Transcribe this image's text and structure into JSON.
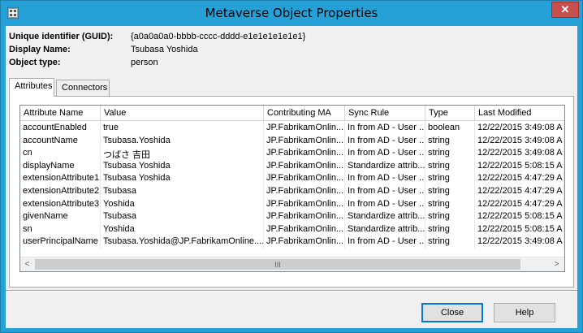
{
  "window": {
    "title": "Metaverse Object Properties",
    "close_glyph": "✕"
  },
  "object": {
    "guid_label": "Unique identifier (GUID):",
    "guid_value": "{a0a0a0a0-bbbb-cccc-dddd-e1e1e1e1e1e1}",
    "display_name_label": "Display Name:",
    "display_name_value": "Tsubasa Yoshida",
    "object_type_label": "Object type:",
    "object_type_value": "person"
  },
  "tabs": [
    {
      "label": "Attributes",
      "active": true
    },
    {
      "label": "Connectors",
      "active": false
    }
  ],
  "grid": {
    "columns": [
      "Attribute Name",
      "Value",
      "Contributing MA",
      "Sync Rule",
      "Type",
      "Last Modified"
    ],
    "rows": [
      [
        "accountEnabled",
        "true",
        "JP.FabrikamOnlin...",
        "In from AD - User ...",
        "boolean",
        "12/22/2015 3:49:08 A"
      ],
      [
        "accountName",
        "Tsubasa.Yoshida",
        "JP.FabrikamOnlin...",
        "In from AD - User ...",
        "string",
        "12/22/2015 3:49:08 A"
      ],
      [
        "cn",
        "つばさ 吉田",
        "JP.FabrikamOnlin...",
        "In from AD - User ...",
        "string",
        "12/22/2015 3:49:08 A"
      ],
      [
        "displayName",
        "Tsubasa Yoshida",
        "JP.FabrikamOnlin...",
        "Standardize attrib...",
        "string",
        "12/22/2015 5:08:15 A"
      ],
      [
        "extensionAttribute1",
        "Tsubasa Yoshida",
        "JP.FabrikamOnlin...",
        "In from AD - User ...",
        "string",
        "12/22/2015 4:47:29 A"
      ],
      [
        "extensionAttribute2",
        "Tsubasa",
        "JP.FabrikamOnlin...",
        "In from AD - User ...",
        "string",
        "12/22/2015 4:47:29 A"
      ],
      [
        "extensionAttribute3",
        "Yoshida",
        "JP.FabrikamOnlin...",
        "In from AD - User ...",
        "string",
        "12/22/2015 4:47:29 A"
      ],
      [
        "givenName",
        "Tsubasa",
        "JP.FabrikamOnlin...",
        "Standardize attrib...",
        "string",
        "12/22/2015 5:08:15 A"
      ],
      [
        "sn",
        "Yoshida",
        "JP.FabrikamOnlin...",
        "Standardize attrib...",
        "string",
        "12/22/2015 5:08:15 A"
      ],
      [
        "userPrincipalName",
        "Tsubasa.Yoshida@JP.FabrikamOnline....",
        "JP.FabrikamOnlin...",
        "In from AD - User ...",
        "string",
        "12/22/2015 3:49:08 A"
      ]
    ],
    "scroll_left_glyph": "<",
    "scroll_right_glyph": ">",
    "scroll_thumb_grip": "III"
  },
  "buttons": {
    "close_label": "Close",
    "help_label": "Help"
  },
  "colors": {
    "title_bar": "#26a1d8",
    "close_button": "#c7504e",
    "dialog_bg": "#f0f0f0"
  }
}
